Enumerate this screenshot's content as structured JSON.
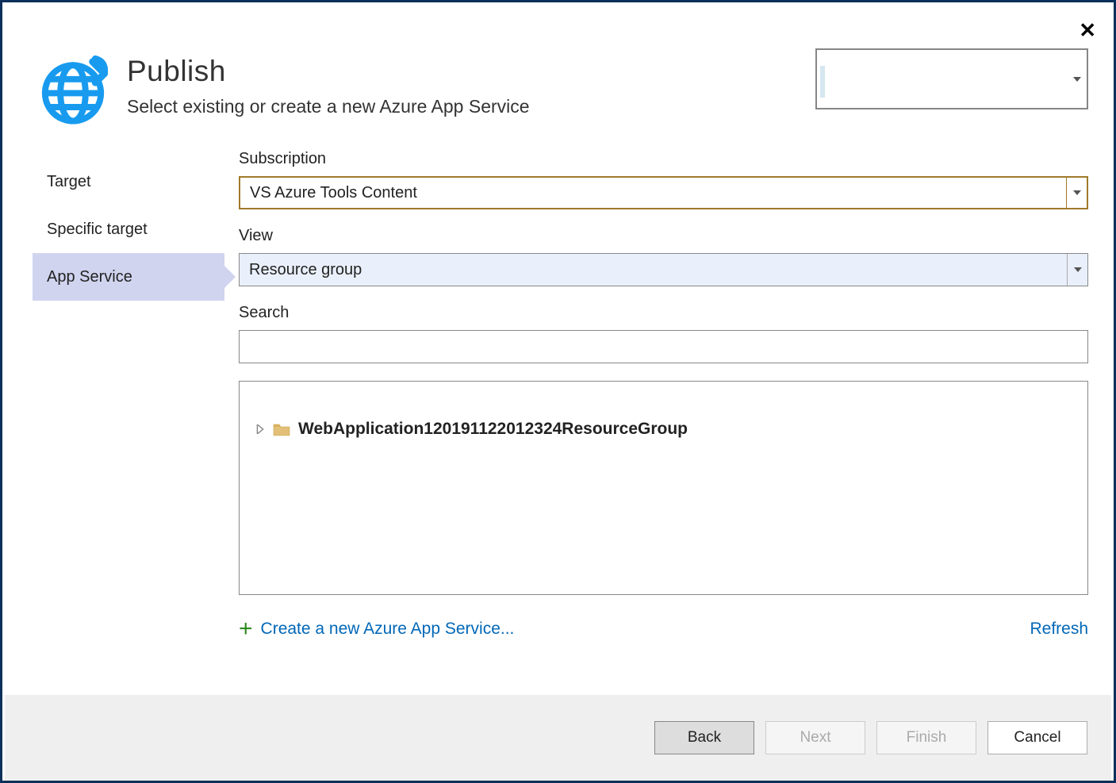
{
  "header": {
    "title": "Publish",
    "subtitle": "Select existing or create a new Azure App Service",
    "account_dropdown_value": ""
  },
  "sidebar": {
    "items": [
      {
        "label": "Target",
        "active": false
      },
      {
        "label": "Specific target",
        "active": false
      },
      {
        "label": "App Service",
        "active": true
      }
    ]
  },
  "fields": {
    "subscription": {
      "label": "Subscription",
      "value": "VS Azure Tools Content"
    },
    "view": {
      "label": "View",
      "value": "Resource group"
    },
    "search": {
      "label": "Search",
      "value": ""
    }
  },
  "tree": {
    "items": [
      {
        "label": "WebApplication120191122012324ResourceGroup"
      }
    ]
  },
  "links": {
    "create": "Create a new Azure App Service...",
    "refresh": "Refresh"
  },
  "buttons": {
    "back": "Back",
    "next": "Next",
    "finish": "Finish",
    "cancel": "Cancel"
  }
}
